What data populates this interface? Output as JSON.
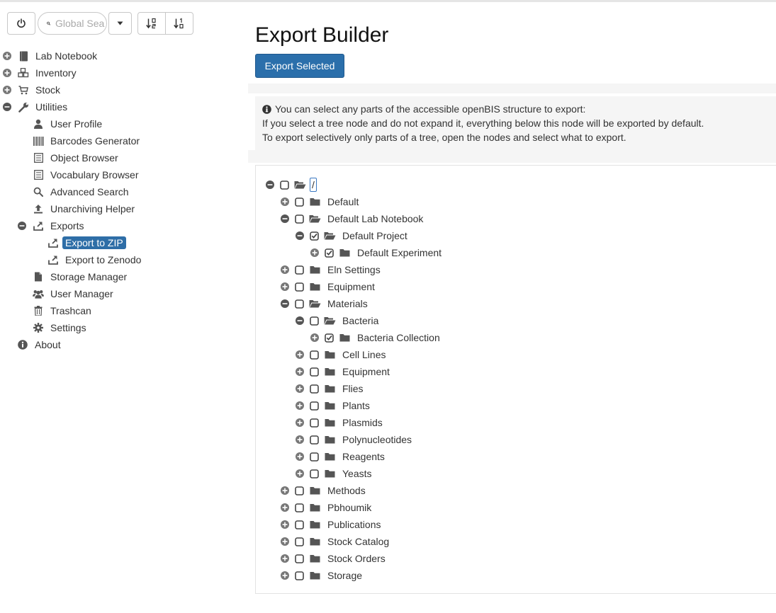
{
  "toolbar": {
    "search_placeholder": "Global Search"
  },
  "sidebar": {
    "items": [
      {
        "label": "Lab Notebook",
        "icon": "notebook-icon",
        "expander": "plus",
        "level": 0
      },
      {
        "label": "Inventory",
        "icon": "cubes-icon",
        "expander": "plus",
        "level": 0
      },
      {
        "label": "Stock",
        "icon": "cart-icon",
        "expander": "plus",
        "level": 0
      },
      {
        "label": "Utilities",
        "icon": "wrench-icon",
        "expander": "minus",
        "level": 0
      },
      {
        "label": "User Profile",
        "icon": "user-icon",
        "expander": "",
        "level": 1
      },
      {
        "label": "Barcodes Generator",
        "icon": "barcode-icon",
        "expander": "",
        "level": 1
      },
      {
        "label": "Object Browser",
        "icon": "list-icon",
        "expander": "",
        "level": 1
      },
      {
        "label": "Vocabulary Browser",
        "icon": "list-icon",
        "expander": "",
        "level": 1
      },
      {
        "label": "Advanced Search",
        "icon": "search-icon",
        "expander": "",
        "level": 1
      },
      {
        "label": "Unarchiving Helper",
        "icon": "upload-icon",
        "expander": "",
        "level": 1
      },
      {
        "label": "Exports",
        "icon": "export-icon",
        "expander": "minus",
        "level": 1
      },
      {
        "label": "Export to ZIP",
        "icon": "export-icon",
        "expander": "",
        "level": 2,
        "selected": true
      },
      {
        "label": "Export to Zenodo",
        "icon": "export-icon",
        "expander": "",
        "level": 2
      },
      {
        "label": "Storage Manager",
        "icon": "file-icon",
        "expander": "",
        "level": 1
      },
      {
        "label": "User Manager",
        "icon": "users-icon",
        "expander": "",
        "level": 1
      },
      {
        "label": "Trashcan",
        "icon": "trash-icon",
        "expander": "",
        "level": 1
      },
      {
        "label": "Settings",
        "icon": "gear-icon",
        "expander": "",
        "level": 1
      },
      {
        "label": "About",
        "icon": "info-icon",
        "expander": "",
        "level": 0.5
      }
    ]
  },
  "main": {
    "title": "Export Builder",
    "export_button": "Export Selected",
    "info": [
      "You can select any parts of the accessible openBIS structure to export:",
      "If you select a tree node and do not expand it, everything below this node will be exported by default.",
      "To export selectively only parts of a tree, open the nodes and select what to export."
    ]
  },
  "tree": [
    {
      "label": "/",
      "level": 0,
      "expander": "minus",
      "checked": false,
      "open": true
    },
    {
      "label": "Default",
      "level": 1,
      "expander": "plus",
      "checked": false,
      "open": false
    },
    {
      "label": "Default Lab Notebook",
      "level": 1,
      "expander": "minus",
      "checked": false,
      "open": true
    },
    {
      "label": "Default Project",
      "level": 2,
      "expander": "minus",
      "checked": true,
      "open": true
    },
    {
      "label": "Default Experiment",
      "level": 3,
      "expander": "plus",
      "checked": true,
      "open": false
    },
    {
      "label": "Eln Settings",
      "level": 1,
      "expander": "plus",
      "checked": false,
      "open": false
    },
    {
      "label": "Equipment",
      "level": 1,
      "expander": "plus",
      "checked": false,
      "open": false
    },
    {
      "label": "Materials",
      "level": 1,
      "expander": "minus",
      "checked": false,
      "open": true
    },
    {
      "label": "Bacteria",
      "level": 2,
      "expander": "minus",
      "checked": false,
      "open": true
    },
    {
      "label": "Bacteria Collection",
      "level": 3,
      "expander": "plus",
      "checked": true,
      "open": false
    },
    {
      "label": "Cell Lines",
      "level": 2,
      "expander": "plus",
      "checked": false,
      "open": false
    },
    {
      "label": "Equipment",
      "level": 2,
      "expander": "plus",
      "checked": false,
      "open": false
    },
    {
      "label": "Flies",
      "level": 2,
      "expander": "plus",
      "checked": false,
      "open": false
    },
    {
      "label": "Plants",
      "level": 2,
      "expander": "plus",
      "checked": false,
      "open": false
    },
    {
      "label": "Plasmids",
      "level": 2,
      "expander": "plus",
      "checked": false,
      "open": false
    },
    {
      "label": "Polynucleotides",
      "level": 2,
      "expander": "plus",
      "checked": false,
      "open": false
    },
    {
      "label": "Reagents",
      "level": 2,
      "expander": "plus",
      "checked": false,
      "open": false
    },
    {
      "label": "Yeasts",
      "level": 2,
      "expander": "plus",
      "checked": false,
      "open": false
    },
    {
      "label": "Methods",
      "level": 1,
      "expander": "plus",
      "checked": false,
      "open": false
    },
    {
      "label": "Pbhoumik",
      "level": 1,
      "expander": "plus",
      "checked": false,
      "open": false
    },
    {
      "label": "Publications",
      "level": 1,
      "expander": "plus",
      "checked": false,
      "open": false
    },
    {
      "label": "Stock Catalog",
      "level": 1,
      "expander": "plus",
      "checked": false,
      "open": false
    },
    {
      "label": "Stock Orders",
      "level": 1,
      "expander": "plus",
      "checked": false,
      "open": false
    },
    {
      "label": "Storage",
      "level": 1,
      "expander": "plus",
      "checked": false,
      "open": false
    }
  ],
  "colors": {
    "accent": "#2b6fab",
    "selected": "#2e6ea7",
    "icon": "#555555",
    "panel": "#f5f5f5"
  }
}
